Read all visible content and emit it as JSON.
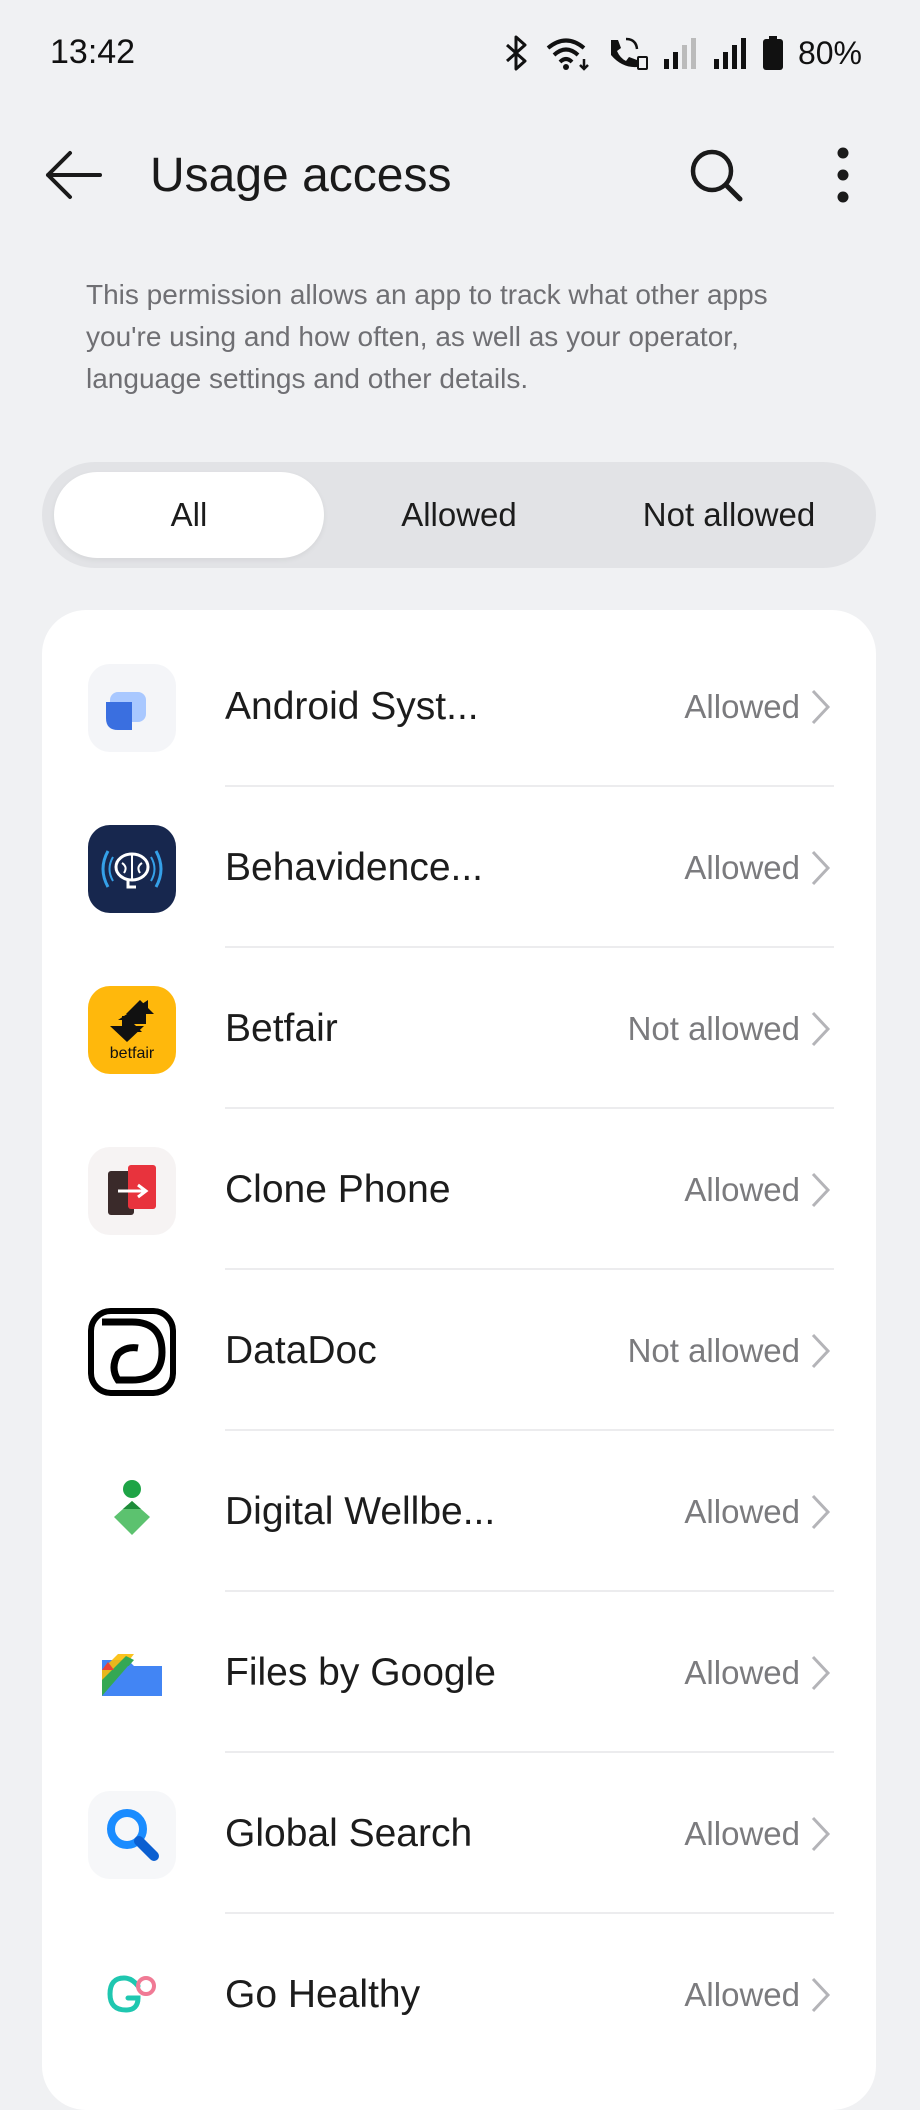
{
  "status_bar": {
    "time": "13:42",
    "battery": "80%",
    "icons": [
      "bluetooth-icon",
      "wifi-icon",
      "wifi-calling-icon",
      "signal-weak-icon",
      "signal-strong-icon",
      "battery-icon"
    ]
  },
  "app_bar": {
    "title": "Usage access",
    "icons": [
      "back-arrow-icon",
      "search-icon",
      "more-vert-icon"
    ]
  },
  "description": "This permission allows an app to track what other apps you're using and how often, as well as your operator, language settings and other details.",
  "tabs": [
    {
      "label": "All",
      "active": true
    },
    {
      "label": "Allowed",
      "active": false
    },
    {
      "label": "Not allowed",
      "active": false
    }
  ],
  "apps": [
    {
      "name": "Android Syst...",
      "status": "Allowed",
      "icon": "android-system-icon"
    },
    {
      "name": "Behavidence...",
      "status": "Allowed",
      "icon": "behavidence-icon"
    },
    {
      "name": "Betfair",
      "status": "Not allowed",
      "icon": "betfair-icon"
    },
    {
      "name": "Clone Phone",
      "status": "Allowed",
      "icon": "clone-phone-icon"
    },
    {
      "name": "DataDoc",
      "status": "Not allowed",
      "icon": "datadoc-icon"
    },
    {
      "name": "Digital Wellbe...",
      "status": "Allowed",
      "icon": "digital-wellbeing-icon"
    },
    {
      "name": "Files by Google",
      "status": "Allowed",
      "icon": "files-by-google-icon"
    },
    {
      "name": "Global Search",
      "status": "Allowed",
      "icon": "global-search-icon"
    },
    {
      "name": "Go Healthy",
      "status": "Allowed",
      "icon": "go-healthy-icon"
    }
  ],
  "betfair_logo_text": "betfair",
  "colors": {
    "background": "#f0f1f3",
    "card": "#ffffff",
    "segment_track": "#e2e3e6",
    "text_primary": "#1c1c1c",
    "text_secondary": "#7b7b7e",
    "betfair_yellow": "#ffb80c",
    "behavidence_blue": "#17274e",
    "search_blue": "#1a8cff"
  }
}
